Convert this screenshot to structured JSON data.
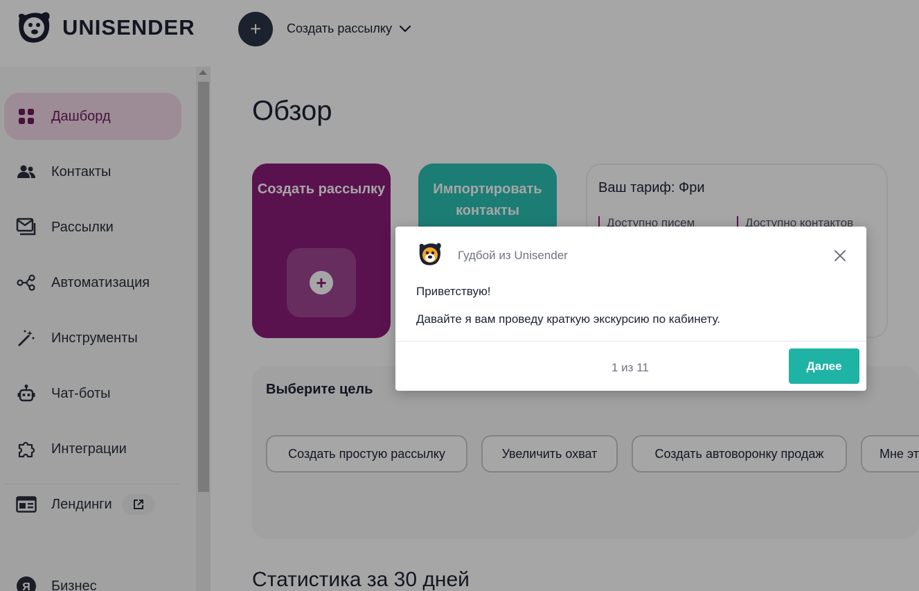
{
  "header": {
    "logo_text": "UNISENDER",
    "create_menu_label": "Создать рассылку"
  },
  "sidebar": {
    "items": [
      {
        "label": "Дашборд",
        "icon": "grid-icon",
        "active": true
      },
      {
        "label": "Контакты",
        "icon": "people-icon"
      },
      {
        "label": "Рассылки",
        "icon": "mail-icon"
      },
      {
        "label": "Автоматизация",
        "icon": "share-nodes-icon"
      },
      {
        "label": "Инструменты",
        "icon": "magic-wand-icon"
      },
      {
        "label": "Чат-боты",
        "icon": "robot-icon"
      },
      {
        "label": "Интеграции",
        "icon": "puzzle-icon"
      },
      {
        "label": "Лендинги",
        "icon": "landing-page-icon",
        "external": true
      },
      {
        "label": "Бизнес",
        "icon": "business-icon"
      }
    ]
  },
  "main": {
    "title": "Обзор",
    "create_card_label": "Создать рассылку",
    "import_card_label": "Импортировать контакты",
    "tariff": {
      "title": "Ваш тариф: Фри",
      "letters_label": "Доступно писем",
      "contacts_label": "Доступно контактов"
    },
    "goal": {
      "title": "Выберите цель",
      "options": [
        "Создать простую рассылку",
        "Увеличить охват",
        "Создать автоворонку продаж",
        "Мне эт"
      ]
    },
    "stats_title": "Статистика за 30 дней"
  },
  "dialog": {
    "sender": "Гудбой из Unisender",
    "greeting": "Приветствую!",
    "message": "Давайте я вам проведу краткую экскурсию по кабинету.",
    "counter": "1 из 11",
    "next_label": "Далее"
  },
  "colors": {
    "brand_purple": "#8a1d7a",
    "teal": "#2cc0b2",
    "next_button": "#1fb3a6",
    "active_nav_bg": "#f2d7e7",
    "dark_fab": "#2a3346"
  }
}
